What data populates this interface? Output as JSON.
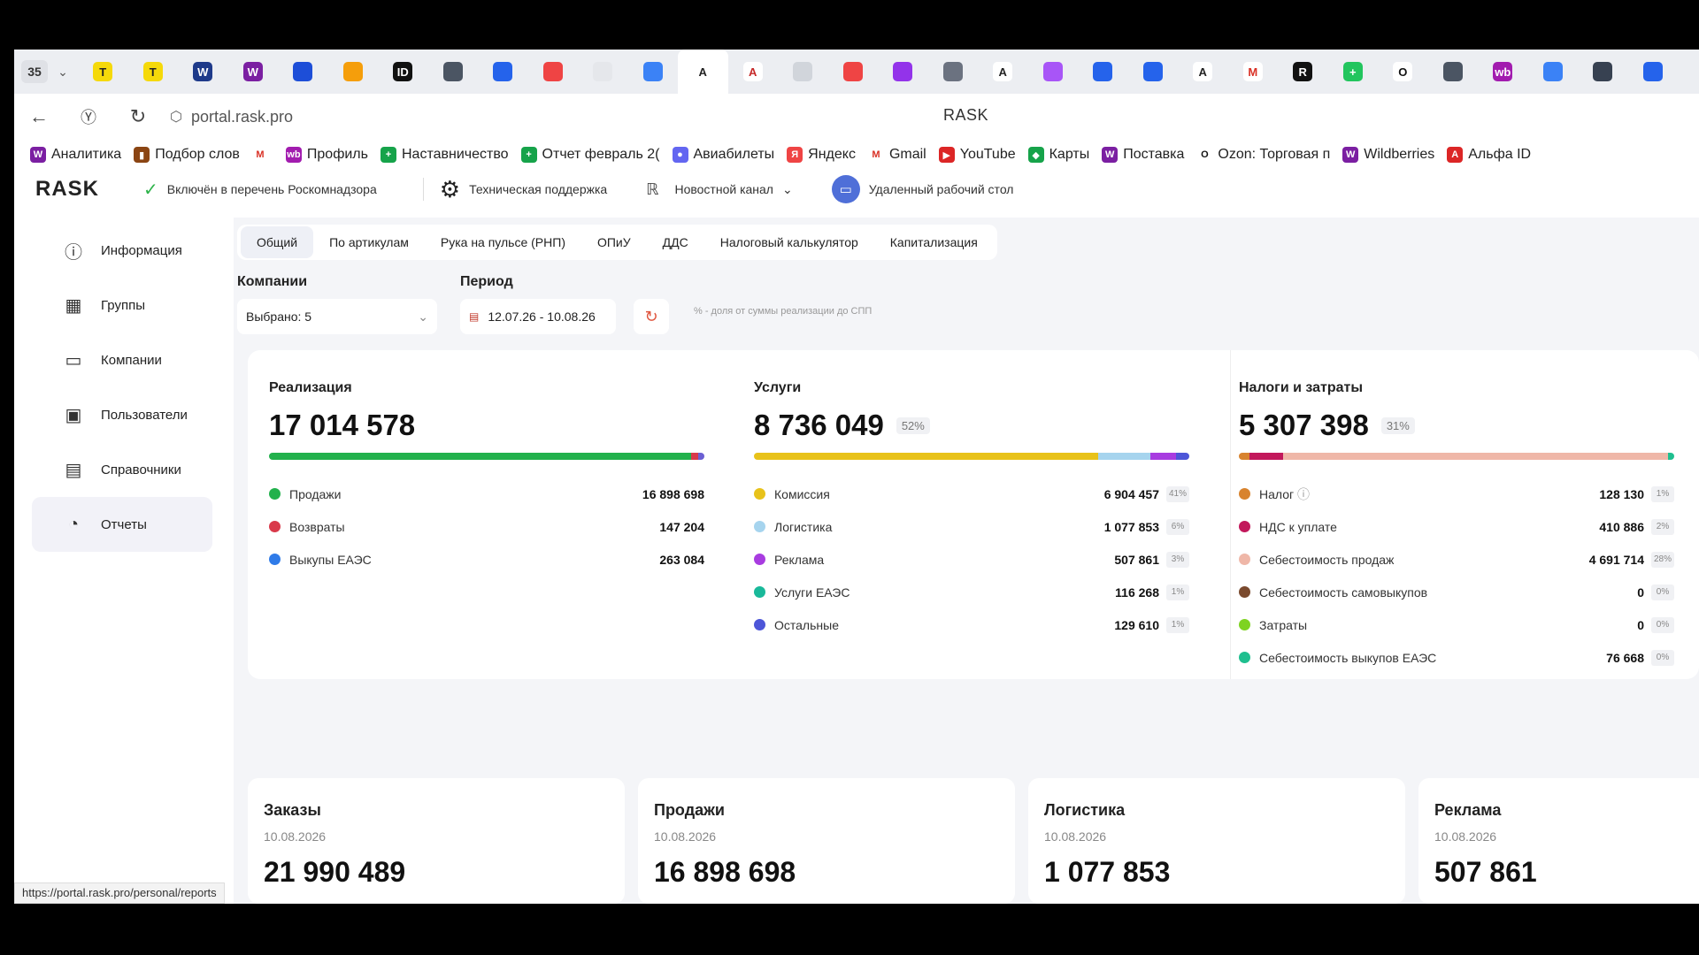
{
  "browser": {
    "tab_count": "35",
    "address": "portal.rask.pro",
    "page_title": "RASK",
    "status_url": "https://portal.rask.pro/personal/reports",
    "favicons": [
      {
        "glyph": "T",
        "bg": "#f5d90a",
        "fg": "#222"
      },
      {
        "glyph": "T",
        "bg": "#f5d90a",
        "fg": "#222"
      },
      {
        "glyph": "W",
        "bg": "#1e3a8a",
        "fg": "#fff"
      },
      {
        "glyph": "W",
        "bg": "#7b1fa2",
        "fg": "#fff"
      },
      {
        "glyph": "",
        "bg": "#1d4ed8",
        "fg": "#fff"
      },
      {
        "glyph": "",
        "bg": "#f59e0b",
        "fg": "#fff"
      },
      {
        "glyph": "ID",
        "bg": "#111",
        "fg": "#fff"
      },
      {
        "glyph": "",
        "bg": "#4b5563",
        "fg": "#fff"
      },
      {
        "glyph": "",
        "bg": "#2563eb",
        "fg": "#fff"
      },
      {
        "glyph": "",
        "bg": "#ef4444",
        "fg": "#fff"
      },
      {
        "glyph": "",
        "bg": "#e5e7eb",
        "fg": "#111"
      },
      {
        "glyph": "",
        "bg": "#3b82f6",
        "fg": "#fff"
      },
      {
        "glyph": "A",
        "bg": "#ffffff",
        "fg": "#222"
      },
      {
        "glyph": "A",
        "bg": "#ffffff",
        "fg": "#c62828"
      },
      {
        "glyph": "",
        "bg": "#d1d5db",
        "fg": "#111"
      },
      {
        "glyph": "",
        "bg": "#ef4444",
        "fg": "#fff"
      },
      {
        "glyph": "",
        "bg": "#9333ea",
        "fg": "#fff"
      },
      {
        "glyph": "",
        "bg": "#6b7280",
        "fg": "#fff"
      },
      {
        "glyph": "A",
        "bg": "#ffffff",
        "fg": "#222"
      },
      {
        "glyph": "",
        "bg": "#a855f7",
        "fg": "#fff"
      },
      {
        "glyph": "",
        "bg": "#2563eb",
        "fg": "#fff"
      },
      {
        "glyph": "",
        "bg": "#2563eb",
        "fg": "#fff"
      },
      {
        "glyph": "A",
        "bg": "#ffffff",
        "fg": "#222"
      },
      {
        "glyph": "M",
        "bg": "#ffffff",
        "fg": "#d93025"
      },
      {
        "glyph": "R",
        "bg": "#111",
        "fg": "#fff"
      },
      {
        "glyph": "+",
        "bg": "#22c55e",
        "fg": "#fff"
      },
      {
        "glyph": "O",
        "bg": "#ffffff",
        "fg": "#111"
      },
      {
        "glyph": "",
        "bg": "#4b5563",
        "fg": "#fff"
      },
      {
        "glyph": "wb",
        "bg": "#a21caf",
        "fg": "#fff"
      },
      {
        "glyph": "",
        "bg": "#3b82f6",
        "fg": "#fff"
      },
      {
        "glyph": "",
        "bg": "#374151",
        "fg": "#fff"
      },
      {
        "glyph": "",
        "bg": "#2563eb",
        "fg": "#fff"
      }
    ]
  },
  "bookmarks": [
    {
      "label": "Аналитика",
      "icon": "W",
      "color": "#7b1fa2"
    },
    {
      "label": "Подбор слов",
      "icon": "▮",
      "color": "#8b4513"
    },
    {
      "label": "",
      "icon": "M",
      "color": "#d93025"
    },
    {
      "label": "Профиль",
      "icon": "wb",
      "color": "#a21caf"
    },
    {
      "label": "Наставничество",
      "icon": "+",
      "color": "#16a34a"
    },
    {
      "label": "Отчет февраль 2(",
      "icon": "+",
      "color": "#16a34a"
    },
    {
      "label": "Авиабилеты",
      "icon": "●",
      "color": "#6366f1"
    },
    {
      "label": "Яндекс",
      "icon": "Я",
      "color": "#ef4444"
    },
    {
      "label": "Gmail",
      "icon": "M",
      "color": "#d93025"
    },
    {
      "label": "YouTube",
      "icon": "▶",
      "color": "#dc2626"
    },
    {
      "label": "Карты",
      "icon": "◆",
      "color": "#16a34a"
    },
    {
      "label": "Поставка",
      "icon": "W",
      "color": "#7b1fa2"
    },
    {
      "label": "Ozon: Торговая п",
      "icon": "O",
      "color": "#111"
    },
    {
      "label": "Wildberries",
      "icon": "W",
      "color": "#7b1fa2"
    },
    {
      "label": "Альфа ID",
      "icon": "A",
      "color": "#dc2626"
    }
  ],
  "header": {
    "logo": "RASK",
    "registry": "Включён в перечень Роскомнадзора",
    "support": "Техническая поддержка",
    "news": "Новостной канал",
    "remote": "Удаленный рабочий стол"
  },
  "sidebar": [
    {
      "label": "Информация",
      "icon": "info-icon"
    },
    {
      "label": "Группы",
      "icon": "groups-icon"
    },
    {
      "label": "Компании",
      "icon": "briefcase-icon"
    },
    {
      "label": "Пользователи",
      "icon": "user-icon"
    },
    {
      "label": "Справочники",
      "icon": "document-icon"
    },
    {
      "label": "Отчеты",
      "icon": "chart-icon"
    }
  ],
  "tabs": [
    "Общий",
    "По артикулам",
    "Рука на пульсе (РНП)",
    "ОПиУ",
    "ДДС",
    "Налоговый калькулятор",
    "Капитализация"
  ],
  "filters": {
    "companies_label": "Компании",
    "companies_value": "Выбрано: 5",
    "period_label": "Период",
    "period_value": "12.07.26 - 10.08.26",
    "note": "% - доля от суммы реализации до СПП"
  },
  "summary": {
    "realization": {
      "title": "Реализация",
      "total": "17 014 578",
      "rows": [
        {
          "label": "Продажи",
          "value": "16 898 698",
          "color": "#22b14c"
        },
        {
          "label": "Возвраты",
          "value": "147 204",
          "color": "#d9394a"
        },
        {
          "label": "Выкупы ЕАЭС",
          "value": "263 084",
          "color": "#2f7be8"
        }
      ],
      "bar": [
        {
          "share": 0.97,
          "color": "#22b14c"
        },
        {
          "share": 0.015,
          "color": "#d9394a"
        },
        {
          "share": 0.015,
          "color": "#6b5fd3"
        }
      ]
    },
    "services": {
      "title": "Услуги",
      "total": "8 736 049",
      "pct": "52%",
      "rows": [
        {
          "label": "Комиссия",
          "value": "6 904 457",
          "pct": "41%",
          "color": "#e8c21a"
        },
        {
          "label": "Логистика",
          "value": "1 077 853",
          "pct": "6%",
          "color": "#a6d4ee"
        },
        {
          "label": "Реклама",
          "value": "507 861",
          "pct": "3%",
          "color": "#a83ce0"
        },
        {
          "label": "Услуги ЕАЭС",
          "value": "116 268",
          "pct": "1%",
          "color": "#19b99a"
        },
        {
          "label": "Остальные",
          "value": "129 610",
          "pct": "1%",
          "color": "#4d56d8"
        }
      ],
      "bar": [
        {
          "share": 0.79,
          "color": "#e8c21a"
        },
        {
          "share": 0.12,
          "color": "#a6d4ee"
        },
        {
          "share": 0.06,
          "color": "#a83ce0"
        },
        {
          "share": 0.03,
          "color": "#4d56d8"
        }
      ]
    },
    "taxes": {
      "title": "Налоги и затраты",
      "total": "5 307 398",
      "pct": "31%",
      "rows": [
        {
          "label": "Налог",
          "value": "128 130",
          "pct": "1%",
          "color": "#d8832e",
          "info": true
        },
        {
          "label": "НДС к уплате",
          "value": "410 886",
          "pct": "2%",
          "color": "#c2185b"
        },
        {
          "label": "Себестоимость продаж",
          "value": "4 691 714",
          "pct": "28%",
          "color": "#efb7a8"
        },
        {
          "label": "Себестоимость самовыкупов",
          "value": "0",
          "pct": "0%",
          "color": "#7a4a2e"
        },
        {
          "label": "Затраты",
          "value": "0",
          "pct": "0%",
          "color": "#7ed321"
        },
        {
          "label": "Себестоимость выкупов ЕАЭС",
          "value": "76 668",
          "pct": "0%",
          "color": "#1fbf8f"
        }
      ],
      "bar": [
        {
          "share": 0.025,
          "color": "#d8832e"
        },
        {
          "share": 0.077,
          "color": "#c2185b"
        },
        {
          "share": 0.883,
          "color": "#efb7a8"
        },
        {
          "share": 0.015,
          "color": "#1fbf8f"
        }
      ]
    }
  },
  "kpis": [
    {
      "title": "Заказы",
      "date": "10.08.2026",
      "value": "21 990 489"
    },
    {
      "title": "Продажи",
      "date": "10.08.2026",
      "value": "16 898 698"
    },
    {
      "title": "Логистика",
      "date": "10.08.2026",
      "value": "1 077 853"
    },
    {
      "title": "Реклама",
      "date": "10.08.2026",
      "value": "507 861"
    }
  ]
}
